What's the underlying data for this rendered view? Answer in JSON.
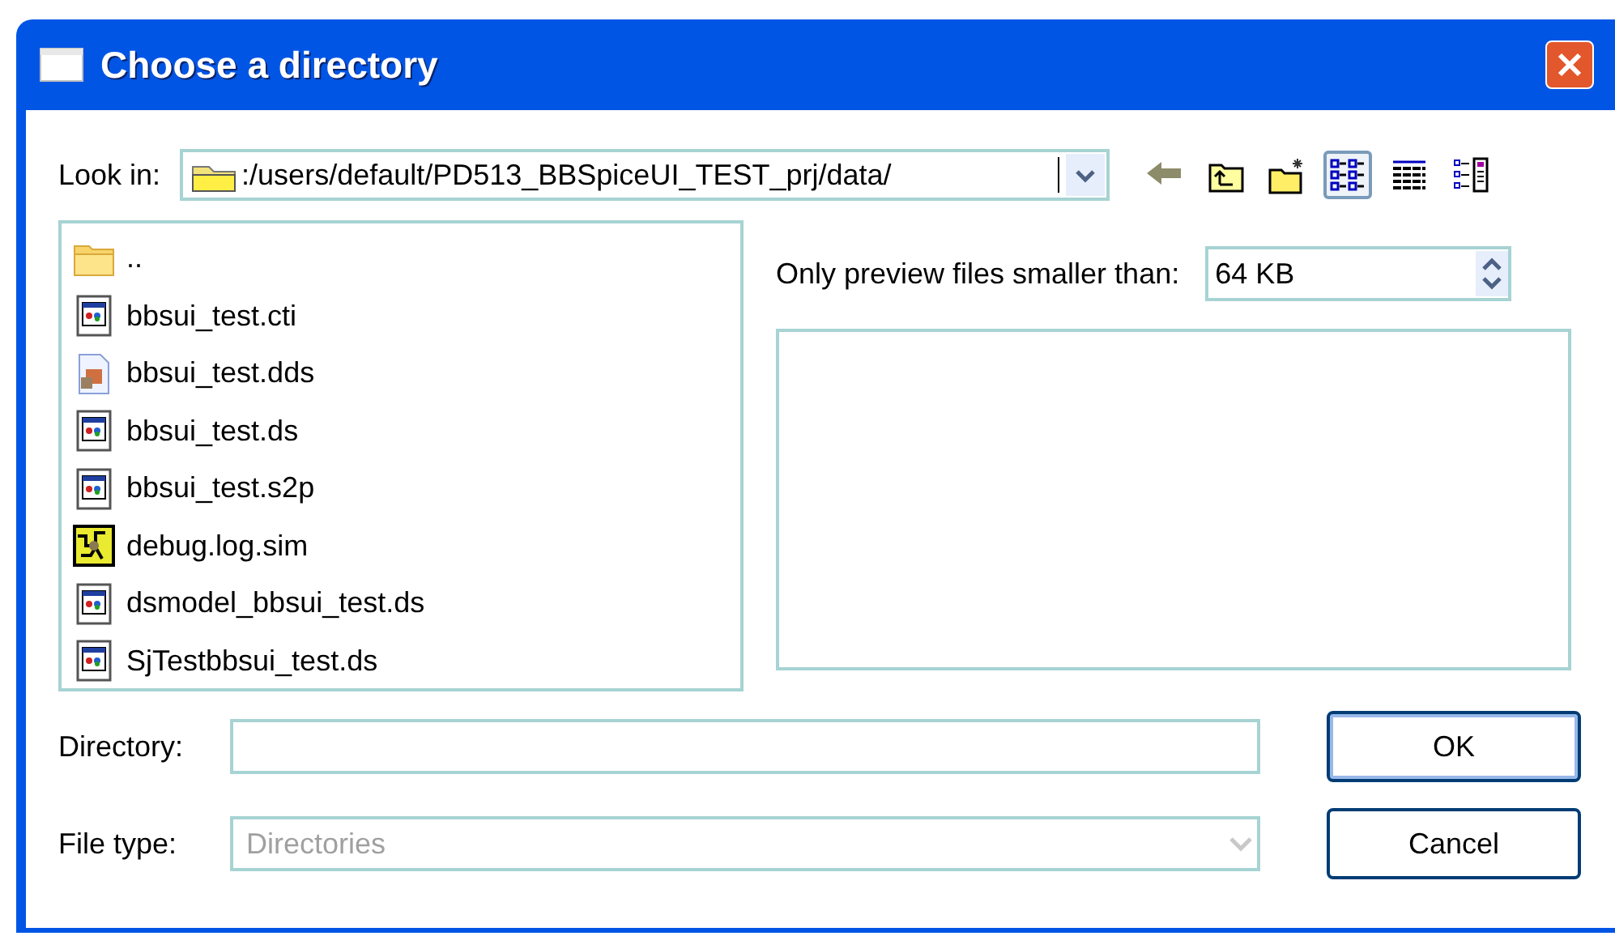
{
  "window": {
    "title": "Choose a directory"
  },
  "look_in": {
    "label": "Look in:",
    "path": ":/users/default/PD513_BBSpiceUI_TEST_prj/data/"
  },
  "toolbar": [
    {
      "kind": "back",
      "selected": false
    },
    {
      "kind": "up",
      "selected": false
    },
    {
      "kind": "newfolder",
      "selected": false
    },
    {
      "kind": "list",
      "selected": true
    },
    {
      "kind": "detail",
      "selected": false
    },
    {
      "kind": "preview",
      "selected": false
    }
  ],
  "files": [
    {
      "name": "..",
      "kind": "folder"
    },
    {
      "name": "bbsui_test.cti",
      "kind": "app"
    },
    {
      "name": "bbsui_test.dds",
      "kind": "image"
    },
    {
      "name": "bbsui_test.ds",
      "kind": "app"
    },
    {
      "name": "bbsui_test.s2p",
      "kind": "app"
    },
    {
      "name": "debug.log.sim",
      "kind": "sim"
    },
    {
      "name": "dsmodel_bbsui_test.ds",
      "kind": "app"
    },
    {
      "name": "SjTestbbsui_test.ds",
      "kind": "app"
    }
  ],
  "preview": {
    "label": "Only preview files smaller than:",
    "value": "64 KB"
  },
  "directory": {
    "label": "Directory:"
  },
  "file_type": {
    "label": "File type:",
    "value": "Directories",
    "disabled": true
  },
  "buttons": [
    {
      "label": "OK",
      "default": true
    },
    {
      "label": "Cancel",
      "default": false
    }
  ]
}
